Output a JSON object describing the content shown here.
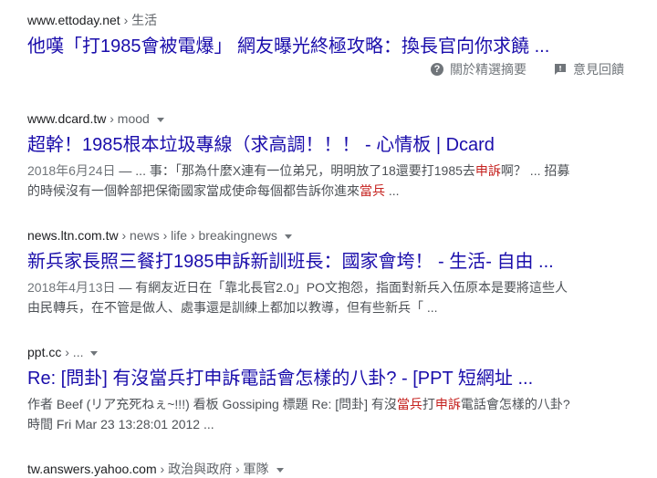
{
  "results": [
    {
      "cite_domain": "www.ettoday.net",
      "cite_path": " › 生活",
      "title": "他嘆「打1985會被電爆」 網友曝光終極攻略：換長官向你求饒 ..."
    },
    {
      "cite_domain": "www.dcard.tw",
      "cite_path": " › mood",
      "title": "超幹！1985根本垃圾專線（求高調！！！ - 心情板 | Dcard",
      "snippet": {
        "date": "2018年6月24日",
        "t1": " — ... 事：「那為什麼X連有一位弟兄，明明放了18還要打1985去",
        "h1": "申訴",
        "t2": "啊？ ... 招募的時候沒有一個幹部把保衛國家當成使命每個都告訴你進來",
        "h2": "當兵",
        "t3": " ..."
      }
    },
    {
      "cite_domain": "news.ltn.com.tw",
      "cite_path": " › news › life › breakingnews",
      "title": "新兵家長照三餐打1985申訴新訓班長：國家會垮！ - 生活- 自由 ...",
      "snippet": {
        "date": "2018年4月13日",
        "text": " — 有網友近日在「靠北長官2.0」PO文抱怨，指面對新兵入伍原本是要將這些人由民轉兵，在不管是做人、處事還是訓練上都加以教導，但有些新兵「 ..."
      }
    },
    {
      "cite_domain": "ppt.cc",
      "cite_path": " › ...",
      "title": "Re: [問卦] 有沒當兵打申訴電話會怎樣的八卦? - [PPT 短網址 ...",
      "snippet": {
        "t1": "作者 Beef (リア充死ねぇ~!!!) 看板 Gossiping 標題 Re: [問卦] 有沒",
        "h1": "當兵",
        "t2": "打",
        "h2": "申訴",
        "t3": "電話會怎樣的八卦? 時間 Fri Mar 23 13:28:01 2012 ..."
      }
    },
    {
      "cite_domain": "tw.answers.yahoo.com",
      "cite_path": " › 政治與政府 › 軍隊"
    }
  ],
  "actions": {
    "about_snippets": "關於精選摘要",
    "feedback": "意見回饋"
  }
}
